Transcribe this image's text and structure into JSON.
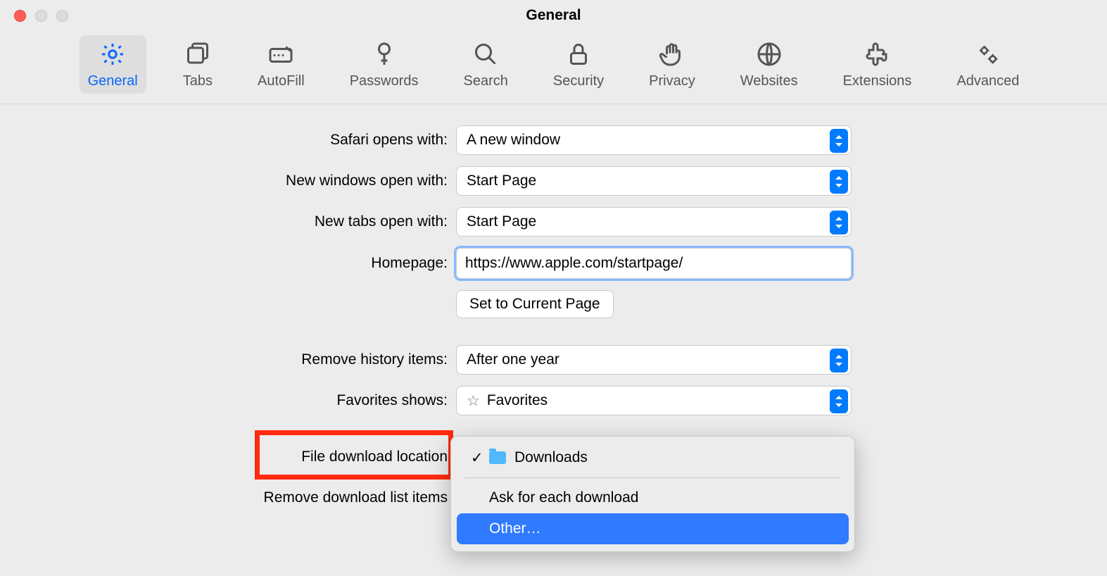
{
  "title": "General",
  "tabs": {
    "general": "General",
    "tabs": "Tabs",
    "autofill": "AutoFill",
    "passwords": "Passwords",
    "search": "Search",
    "security": "Security",
    "privacy": "Privacy",
    "websites": "Websites",
    "extensions": "Extensions",
    "advanced": "Advanced"
  },
  "labels": {
    "opens_with": "Safari opens with:",
    "new_windows": "New windows open with:",
    "new_tabs": "New tabs open with:",
    "homepage": "Homepage:",
    "remove_history": "Remove history items:",
    "favorites": "Favorites shows:",
    "download_loc": "File download location",
    "remove_dl": "Remove download list items"
  },
  "values": {
    "opens_with": "A new window",
    "new_windows": "Start Page",
    "new_tabs": "Start Page",
    "homepage": "https://www.apple.com/startpage/",
    "remove_history": "After one year",
    "favorites": "Favorites"
  },
  "buttons": {
    "set_current": "Set to Current Page"
  },
  "popup": {
    "downloads": "Downloads",
    "ask": "Ask for each download",
    "other": "Other…"
  }
}
